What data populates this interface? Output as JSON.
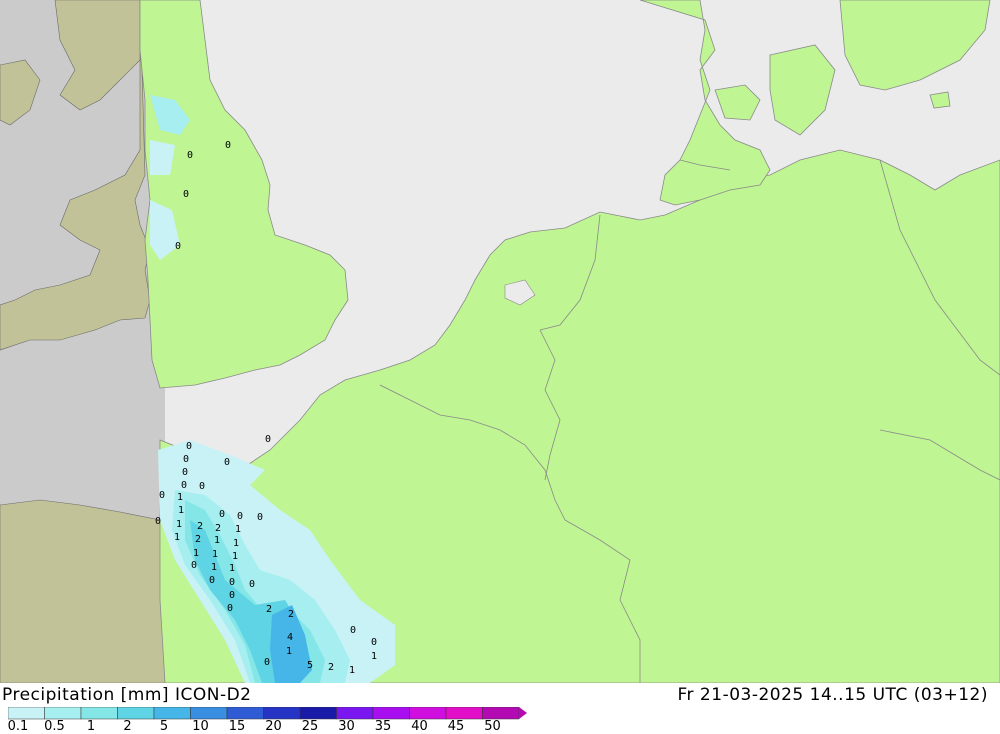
{
  "title": {
    "variable": "Precipitation",
    "unit": "[mm]",
    "model": "ICON-D2",
    "valid_time": "Fr 21-03-2025 14..15 UTC (03+12)"
  },
  "legend": {
    "levels": [
      "0.1",
      "0.5",
      "1",
      "2",
      "5",
      "10",
      "15",
      "20",
      "25",
      "30",
      "35",
      "40",
      "45",
      "50"
    ],
    "colors": [
      "#c8f2f6",
      "#a6eef0",
      "#84e6e6",
      "#5fd4e4",
      "#46b6e8",
      "#3a8ee2",
      "#2f5cd4",
      "#2534c4",
      "#1a1aa8",
      "#7a16f0",
      "#a80ef0",
      "#d00ee0",
      "#e20ec8",
      "#b40ab4"
    ]
  },
  "map_values": [
    "0",
    "0",
    "0",
    "0",
    "0",
    "0",
    "0",
    "0",
    "0",
    "0",
    "0",
    "0",
    "1",
    "1",
    "1",
    "2",
    "2",
    "1",
    "1",
    "1",
    "0",
    "0",
    "0",
    "0",
    "1",
    "1",
    "1",
    "1",
    "1",
    "1",
    "0",
    "0",
    "0",
    "0",
    "0",
    "0",
    "2",
    "2",
    "2",
    "4",
    "5",
    "2",
    "1",
    "1",
    "0",
    "0",
    "0",
    "1"
  ]
}
